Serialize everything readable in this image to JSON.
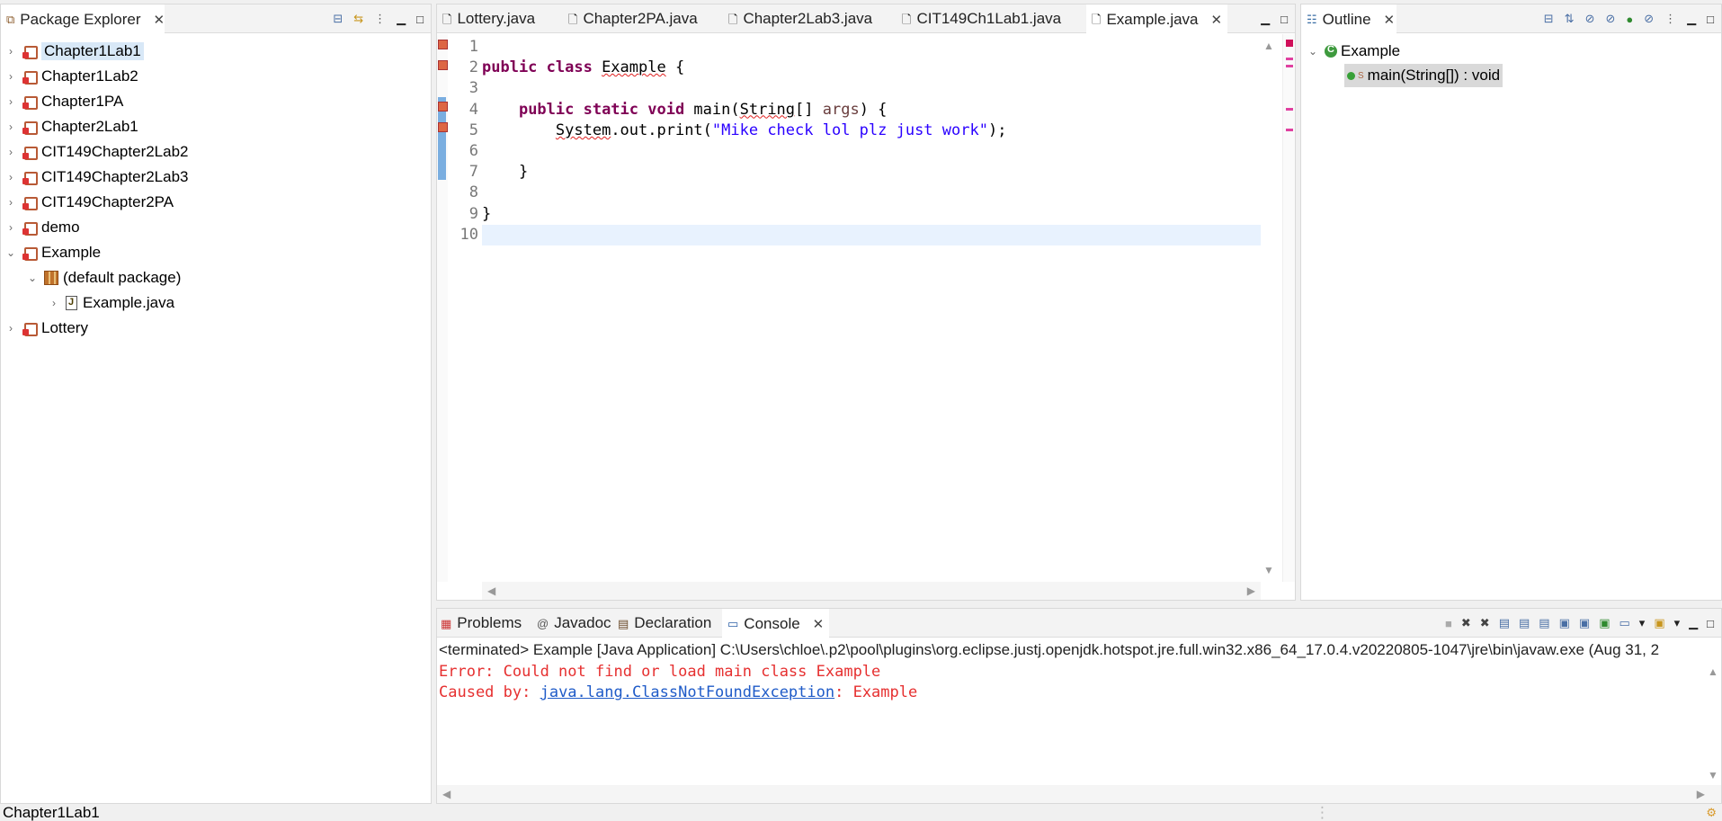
{
  "package_explorer": {
    "tab_label": "Package Explorer",
    "items": [
      {
        "label": "Chapter1Lab1",
        "expanded": false,
        "selected": true
      },
      {
        "label": "Chapter1Lab2",
        "expanded": false
      },
      {
        "label": "Chapter1PA",
        "expanded": false
      },
      {
        "label": "Chapter2Lab1",
        "expanded": false
      },
      {
        "label": "CIT149Chapter2Lab2",
        "expanded": false
      },
      {
        "label": "CIT149Chapter2Lab3",
        "expanded": false
      },
      {
        "label": "CIT149Chapter2PA",
        "expanded": false
      },
      {
        "label": "demo",
        "expanded": false
      },
      {
        "label": "Example",
        "expanded": true
      },
      {
        "label": "(default package)",
        "expanded": true
      },
      {
        "label": "Example.java",
        "expanded": false
      },
      {
        "label": "Lottery",
        "expanded": false
      }
    ]
  },
  "editor": {
    "tabs": [
      {
        "label": "Lottery.java"
      },
      {
        "label": "Chapter2PA.java"
      },
      {
        "label": "Chapter2Lab3.java"
      },
      {
        "label": "CIT149Ch1Lab1.java"
      },
      {
        "label": "Example.java",
        "active": true
      }
    ],
    "line_numbers": [
      "1",
      "2",
      "3",
      "4",
      "5",
      "6",
      "7",
      "8",
      "9",
      "10"
    ],
    "code": {
      "line2_kw": "public class ",
      "line2_class": "Example",
      "line2_brace": " {",
      "line4_indent": "    ",
      "line4_kw": "public static void ",
      "line4_method": "main(",
      "line4_type": "String",
      "line4_rest": "[] ",
      "line4_arg": "args",
      "line4_end": ") {",
      "line5_indent": "        ",
      "line5_system": "System",
      "line5_call": ".out.print(",
      "line5_string": "\"Mike check lol plz just work\"",
      "line5_end": ");",
      "line7": "    }",
      "line9": "}"
    }
  },
  "outline": {
    "tab_label": "Outline",
    "class_name": "Example",
    "method": "main(String[]) : void",
    "static_marker": "S"
  },
  "console_view": {
    "tabs": [
      "Problems",
      "Javadoc",
      "Declaration",
      "Console"
    ],
    "active_tab": "Console",
    "terminated_line": "<terminated> Example [Java Application] C:\\Users\\chloe\\.p2\\pool\\plugins\\org.eclipse.justj.openjdk.hotspot.jre.full.win32.x86_64_17.0.4.v20220805-1047\\jre\\bin\\javaw.exe  (Aug 31, 2",
    "error_line": "Error: Could not find or load main class Example",
    "caused_prefix": "Caused by: ",
    "caused_link": "java.lang.ClassNotFoundException",
    "caused_suffix": ": Example"
  },
  "status_bar": {
    "text": "Chapter1Lab1"
  },
  "colors": {
    "keyword": "#7f0055",
    "string": "#2a00ff",
    "error_text": "#e63030",
    "link": "#1f5bc8",
    "selection": "#d8e8f7"
  }
}
